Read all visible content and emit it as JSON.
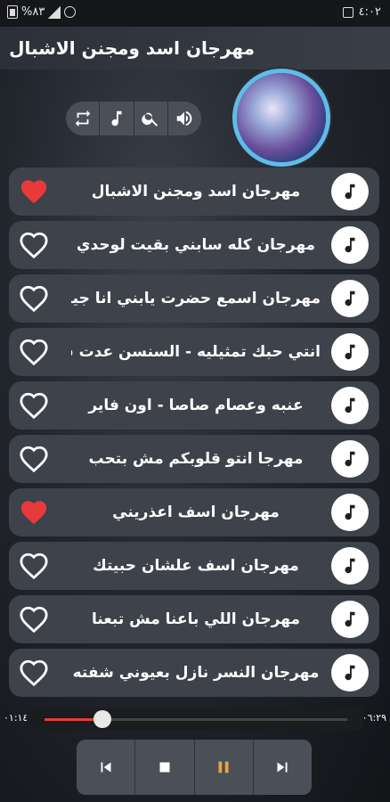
{
  "status_bar": {
    "left_text": "%٨٣",
    "time": "٤:٠٢",
    "icons": [
      "battery-icon",
      "signal-icon",
      "alarm-icon",
      "notification-icon"
    ]
  },
  "header": {
    "title": "مهرجان اسد ومجنن الاشبال"
  },
  "controls": {
    "icons": [
      "repeat-icon",
      "music-note-icon",
      "search-icon",
      "volume-icon"
    ]
  },
  "songs": [
    {
      "title": "مهرجان اسد ومجنن الاشبال",
      "favorite": true
    },
    {
      "title": "مهرجان كله سابني بقيت لوحدي",
      "favorite": false
    },
    {
      "title": "مهرجان اسمع حضرت يابني انا جيت",
      "favorite": false
    },
    {
      "title": "انتي حبك تمثيليه - السنسن عدت ف...",
      "favorite": false
    },
    {
      "title": "عنبه وعصام صاصا - اون فاير",
      "favorite": false
    },
    {
      "title": "مهرجا انتو قلوبكم مش بتحب",
      "favorite": false
    },
    {
      "title": "مهرجان اسف اعذريني",
      "favorite": true
    },
    {
      "title": "مهرجان اسف علشان حبيتك",
      "favorite": false
    },
    {
      "title": "مهرجان اللي باعنا مش تبعنا",
      "favorite": false
    },
    {
      "title": "مهرجان النسر نازل بعيوني شفته",
      "favorite": false
    }
  ],
  "progress": {
    "elapsed": "٠١:١٤",
    "total": "٠٦:٢٩",
    "fraction": 0.19
  },
  "player": {
    "buttons": [
      "previous-icon",
      "stop-icon",
      "pause-icon",
      "next-icon"
    ]
  },
  "colors": {
    "accent": "#e83a3a",
    "pause": "#f0a43a",
    "row_bg": "#3d424b"
  }
}
